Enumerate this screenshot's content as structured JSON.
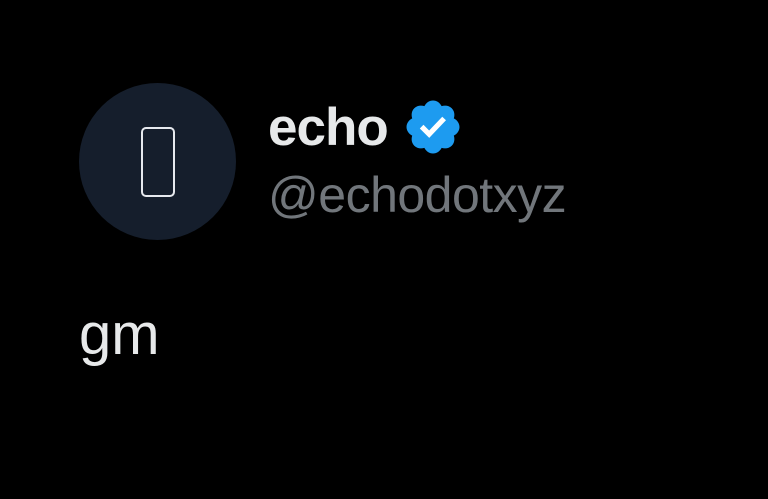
{
  "tweet": {
    "author": {
      "display_name": "echo",
      "handle": "@echodotxyz",
      "verified": true,
      "verified_color": "#1d9bf0",
      "avatar_icon": "echo-logo-icon"
    },
    "text": "gm"
  },
  "colors": {
    "background": "#000000",
    "primary_text": "#e7e9ea",
    "secondary_text": "#71767b",
    "avatar_bg": "#151e2c"
  }
}
